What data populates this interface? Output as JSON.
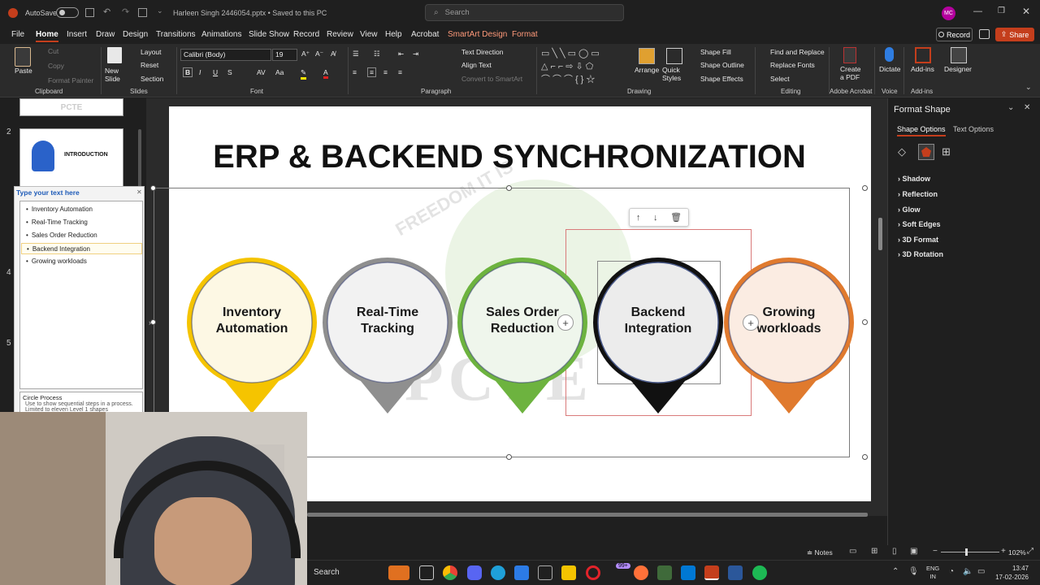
{
  "titlebar": {
    "autosave_label": "AutoSave",
    "autosave_state": "Off",
    "file_title": "Harleen Singh 2446054.pptx • Saved to this PC",
    "search_placeholder": "Search",
    "avatar_initials": "MC"
  },
  "menu": {
    "tabs": [
      "File",
      "Home",
      "Insert",
      "Draw",
      "Design",
      "Transitions",
      "Animations",
      "Slide Show",
      "Record",
      "Review",
      "View",
      "Help",
      "Acrobat",
      "SmartArt Design",
      "Format"
    ],
    "active_tab": "Home",
    "record_button": "Record",
    "share_button": "Share"
  },
  "ribbon": {
    "clipboard": {
      "paste": "Paste",
      "cut": "Cut",
      "copy": "Copy",
      "format_painter": "Format Painter",
      "label": "Clipboard"
    },
    "slides": {
      "new_slide": "New Slide",
      "layout": "Layout",
      "reset": "Reset",
      "section": "Section",
      "label": "Slides"
    },
    "font": {
      "name": "Calibri (Body)",
      "size": "19",
      "label": "Font"
    },
    "paragraph": {
      "text_direction": "Text Direction",
      "align_text": "Align Text",
      "convert": "Convert to SmartArt",
      "label": "Paragraph"
    },
    "drawing": {
      "arrange": "Arrange",
      "quick_styles": "Quick Styles",
      "shape_fill": "Shape Fill",
      "shape_outline": "Shape Outline",
      "shape_effects": "Shape Effects",
      "label": "Drawing"
    },
    "editing": {
      "find_replace": "Find and Replace",
      "replace_fonts": "Replace Fonts",
      "select": "Select",
      "label": "Editing"
    },
    "acrobat": {
      "create_pdf": "Create a PDF",
      "label": "Adobe Acrobat"
    },
    "voice": {
      "dictate": "Dictate",
      "label": "Voice"
    },
    "addins": {
      "addins": "Add-ins",
      "label": "Add-ins"
    },
    "designer": {
      "designer": "Designer"
    }
  },
  "thumbnails": {
    "slide_numbers": [
      "2",
      "4",
      "5"
    ],
    "slide2_title": "INTRODUCTION",
    "slide1_caption": "PCTE"
  },
  "textpane": {
    "header": "Type your text here",
    "items": [
      "Inventory Automation",
      "Real-Time Tracking",
      "Sales Order Reduction",
      "Backend Integration",
      "Growing workloads"
    ],
    "footer_title": "Circle Process",
    "footer_desc": "Use to show sequential steps in a process. Limited to eleven Level 1 shapes"
  },
  "slide": {
    "title": "ERP & BACKEND SYNCHRONIZATION",
    "watermark_top": "FREEDOM IT IS",
    "watermark_bottom": "PCTE",
    "pins": [
      {
        "line1": "Inventory",
        "line2": "Automation",
        "color": "#f5c400",
        "fill": "#fdf8e4"
      },
      {
        "line1": "Real-Time",
        "line2": "Tracking",
        "color": "#8f8f8f",
        "fill": "#f2f2f2"
      },
      {
        "line1": "Sales Order",
        "line2": "Reduction",
        "color": "#6db33f",
        "fill": "#eff6ec"
      },
      {
        "line1": "Backend",
        "line2": "Integration",
        "color": "#111111",
        "fill": "#ececec"
      },
      {
        "line1": "Growing",
        "line2": "workloads",
        "color": "#e07a2e",
        "fill": "#fbece2"
      }
    ]
  },
  "format_shape": {
    "title": "Format Shape",
    "tab_shape": "Shape Options",
    "tab_text": "Text Options",
    "sections": [
      "Shadow",
      "Reflection",
      "Glow",
      "Soft Edges",
      "3D Format",
      "3D Rotation"
    ]
  },
  "statusbar": {
    "notes": "Notes",
    "zoom": "102%"
  },
  "taskbar": {
    "search": "Search",
    "lang_line1": "ENG",
    "lang_line2": "IN",
    "time": "13:47",
    "date": "17-02-2026",
    "badge": "99+"
  },
  "colors": {
    "accent": "#c43e1c",
    "smartart_tab": "#ff9a7a"
  }
}
